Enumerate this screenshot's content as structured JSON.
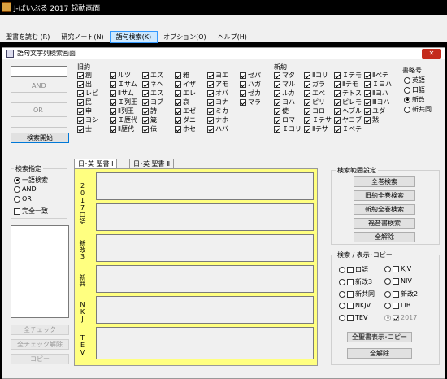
{
  "window": {
    "title": "J-ばいぶる 2017 起動画面"
  },
  "menu": {
    "items": [
      {
        "label": "聖書を読む (R)",
        "selected": false
      },
      {
        "label": "研究ノート(N)",
        "selected": false
      },
      {
        "label": "語句検索(K)",
        "selected": true
      },
      {
        "label": "オプション(O)",
        "selected": false
      },
      {
        "label": "ヘルプ(H)",
        "selected": false
      }
    ]
  },
  "dialog": {
    "title": "語句文字列検索画面",
    "close_label": "✕"
  },
  "search": {
    "and_label": "AND",
    "or_label": "OR",
    "start_button": "検索開始"
  },
  "old_testament": {
    "label": "旧約",
    "books": [
      "創",
      "出",
      "レビ",
      "民",
      "申",
      "ヨシ",
      "士",
      "ルツ",
      "Ｉサム",
      "Ⅱサム",
      "Ｉ列王",
      "Ⅱ列王",
      "Ｉ歴代",
      "Ⅱ歴代",
      "エズ",
      "ネヘ",
      "エス",
      "ヨブ",
      "詩",
      "箴",
      "伝",
      "雅",
      "イザ",
      "エレ",
      "哀",
      "エゼ",
      "ダニ",
      "ホセ",
      "ヨエ",
      "アモ",
      "オバ",
      "ヨナ",
      "ミカ",
      "ナホ",
      "ハバ",
      "ゼパ",
      "ハガ",
      "ゼカ",
      "マラ"
    ]
  },
  "new_testament": {
    "label": "新約",
    "books": [
      "マタ",
      "マル",
      "ルカ",
      "ヨハ",
      "使",
      "ロマ",
      "Ｉコリ",
      "Ⅱコリ",
      "ガラ",
      "エペ",
      "ピリ",
      "コロ",
      "Ｉテサ",
      "Ⅱテサ",
      "Ｉテモ",
      "Ⅱテモ",
      "テトス",
      "ピレモ",
      "ヘブル",
      "ヤコブ",
      "Ｉペテ",
      "Ⅱペテ",
      "Ｉヨハ",
      "Ⅱヨハ",
      "Ⅲヨハ",
      "ユダ",
      "黙"
    ]
  },
  "edition": {
    "label": "書略号",
    "options": [
      {
        "label": "英語",
        "checked": false
      },
      {
        "label": "口語",
        "checked": false
      },
      {
        "label": "新改",
        "checked": true
      },
      {
        "label": "新共同",
        "checked": false
      }
    ]
  },
  "search_spec": {
    "label": "検索指定",
    "options": [
      {
        "label": "一語検索",
        "checked": true
      },
      {
        "label": "AND",
        "checked": false
      },
      {
        "label": "OR",
        "checked": false
      }
    ],
    "exact_label": "完全一致"
  },
  "tabs": [
    {
      "label": "日･英 聖書 Ⅰ",
      "active": true
    },
    {
      "label": "日･英 聖書 Ⅱ",
      "active": false
    }
  ],
  "versions": [
    {
      "label": "2017口語"
    },
    {
      "label": "新改3"
    },
    {
      "label": "新共"
    },
    {
      "label": "NKJ"
    },
    {
      "label": "TEV"
    }
  ],
  "left_buttons": {
    "check_all": "全チェック",
    "uncheck_all": "全チェック解除",
    "copy": "コピー"
  },
  "range": {
    "label": "検索範囲設定",
    "buttons": [
      "全巻検索",
      "旧約全巻検索",
      "新約全巻検索",
      "福音書検索",
      "全解除"
    ]
  },
  "display": {
    "label": "検索 / 表示･コピー",
    "items": [
      {
        "label": "口語",
        "radio": false,
        "check": false,
        "disabled": false
      },
      {
        "label": "KJV",
        "radio": false,
        "check": false,
        "disabled": false
      },
      {
        "label": "新改3",
        "radio": false,
        "check": false,
        "disabled": false
      },
      {
        "label": "NIV",
        "radio": false,
        "check": false,
        "disabled": false
      },
      {
        "label": "新共同",
        "radio": false,
        "check": false,
        "disabled": false
      },
      {
        "label": "新改2",
        "radio": false,
        "check": false,
        "disabled": false
      },
      {
        "label": "NKJV",
        "radio": false,
        "check": false,
        "disabled": false
      },
      {
        "label": "LIB",
        "radio": false,
        "check": false,
        "disabled": false
      },
      {
        "label": "TEV",
        "radio": false,
        "check": false,
        "disabled": false
      },
      {
        "label": "2017",
        "radio": true,
        "check": true,
        "disabled": true
      }
    ],
    "copy_all_button": "全聖書表示･コピー",
    "clear_button": "全解除"
  }
}
